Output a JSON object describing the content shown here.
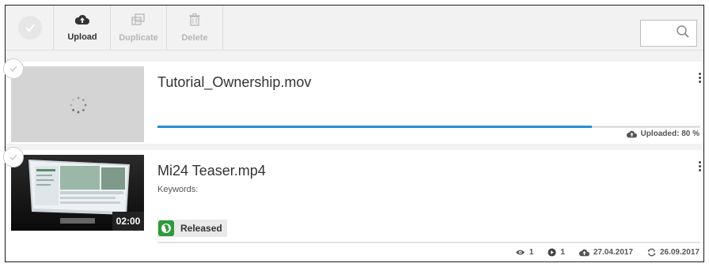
{
  "toolbar": {
    "upload_label": "Upload",
    "duplicate_label": "Duplicate",
    "delete_label": "Delete",
    "search_icon": "search-icon"
  },
  "items": [
    {
      "title": "Tutorial_Ownership.mov",
      "progress": 0.8,
      "status": "Uploaded: 80 %"
    },
    {
      "title": "Mi24 Teaser.mp4",
      "keywords_label": "Keywords:",
      "duration": "02:00",
      "release_status": "Released",
      "views": "1",
      "plays": "1",
      "uploaded_date": "27.04.2017",
      "updated_date": "26.09.2017"
    }
  ],
  "colors": {
    "accent": "#2a8fd1",
    "released": "#2e9a3a",
    "toolbar_bg": "#f2f2f2"
  }
}
